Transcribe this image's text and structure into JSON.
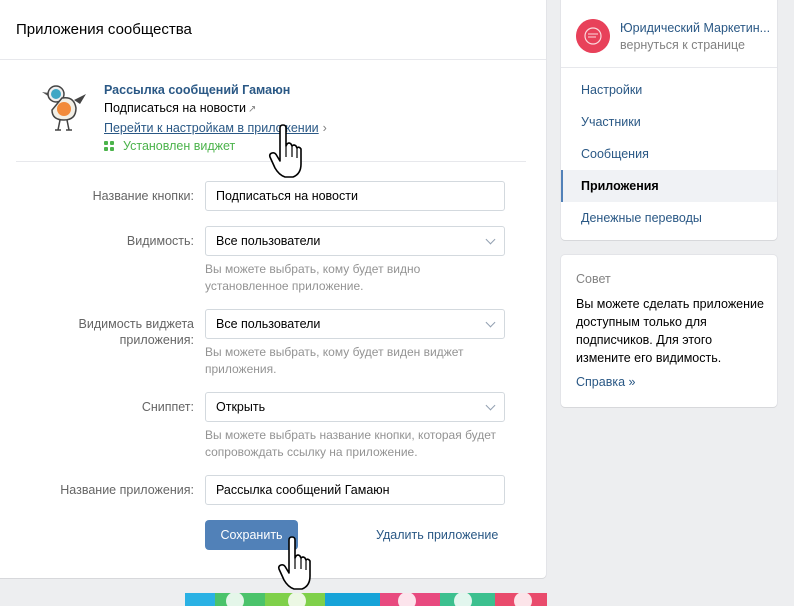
{
  "page": {
    "title": "Приложения сообщества"
  },
  "app": {
    "name": "Рассылка сообщений Гамаюн",
    "subscribe_text": "Подписаться на новости",
    "settings_link": "Перейти к настройкам в приложении",
    "widget_status": "Установлен виджет"
  },
  "form": {
    "button_name": {
      "label": "Название кнопки:",
      "value": "Подписаться на новости"
    },
    "visibility": {
      "label": "Видимость:",
      "value": "Все пользователи",
      "hint": "Вы можете выбрать, кому будет видно установленное приложение."
    },
    "widget_visibility": {
      "label": "Видимость виджета приложения:",
      "value": "Все пользователи",
      "hint": "Вы можете выбрать, кому будет виден виджет приложения."
    },
    "snippet": {
      "label": "Сниппет:",
      "value": "Открыть",
      "hint": "Вы можете выбрать название кнопки, которая будет сопровождать ссылку на приложение."
    },
    "app_name": {
      "label": "Название приложения:",
      "value": "Рассылка сообщений Гамаюн"
    },
    "save_label": "Сохранить",
    "delete_label": "Удалить приложение"
  },
  "sidebar": {
    "group_name": "Юридический Маркетин...",
    "back_link": "вернуться к странице",
    "items": [
      {
        "label": "Настройки"
      },
      {
        "label": "Участники"
      },
      {
        "label": "Сообщения"
      },
      {
        "label": "Приложения",
        "active": true
      },
      {
        "label": "Денежные переводы"
      }
    ]
  },
  "tip": {
    "title": "Совет",
    "text": "Вы можете сделать приложение доступным только для подписчиков. Для этого измените его видимость.",
    "link": "Справка »"
  },
  "colors": {
    "link": "#2a5885",
    "button": "#5181b8",
    "success": "#4bb34b",
    "group_avatar": "#e8415a"
  },
  "icons": [
    "bird-logo-icon",
    "external-link-icon",
    "chevron-right-icon",
    "widget-grid-icon",
    "dropdown-arrow-icon",
    "hand-cursor-icon"
  ]
}
